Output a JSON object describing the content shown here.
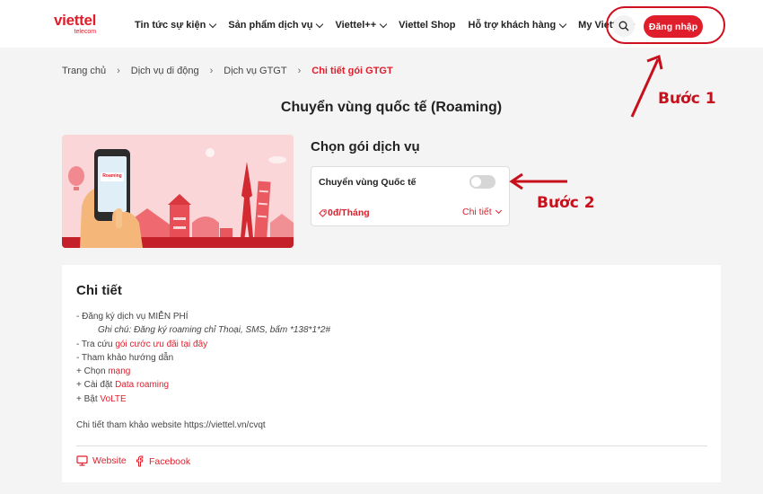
{
  "header": {
    "logo_brand": "viettel",
    "logo_sub": "telecom",
    "nav": [
      {
        "label": "Tin tức sự kiện",
        "has_dropdown": true
      },
      {
        "label": "Sản phẩm dịch vụ",
        "has_dropdown": true
      },
      {
        "label": "Viettel++",
        "has_dropdown": true
      },
      {
        "label": "Viettel Shop",
        "has_dropdown": false
      },
      {
        "label": "Hỗ trợ khách hàng",
        "has_dropdown": true
      },
      {
        "label": "My Viettel",
        "has_dropdown": true
      }
    ],
    "login_label": "Đăng nhập"
  },
  "annotations": {
    "step1": "Bước 1",
    "step2": "Bước 2",
    "color": "#d0101e"
  },
  "breadcrumb": [
    "Trang chủ",
    "Dịch vụ di động",
    "Dịch vụ GTGT",
    "Chi tiết gói GTGT"
  ],
  "page_title": "Chuyển vùng quốc tế (Roaming)",
  "banner": {
    "phone_label": "Roaming"
  },
  "package": {
    "heading": "Chọn gói dịch vụ",
    "name": "Chuyển vùng Quốc tế",
    "toggle_on": false,
    "price": "0đ/Tháng",
    "detail_label": "Chi tiết"
  },
  "details": {
    "title": "Chi tiết",
    "register": "- Đăng ký dịch vụ MIỄN PHÍ",
    "note": "Ghi chú: Đăng ký roaming chỉ Thoại, SMS, bấm *138*1*2#",
    "lookup_prefix": "- Tra cứu ",
    "lookup_link": "gói cước ưu đãi tại đây",
    "guide": "- Tham khảo hướng dẫn",
    "choose_prefix": "+ Chọn ",
    "choose_link": "mạng",
    "settings_prefix": "+ Cài đặt ",
    "settings_link": "Data roaming",
    "enable_prefix": "+ Bật ",
    "enable_link": "VoLTE",
    "reference": "Chi tiết tham khảo website https://viettel.vn/cvqt",
    "website_label": "Website",
    "facebook_label": "Facebook"
  },
  "colors": {
    "brand_red": "#e01e2b",
    "background": "#f4f4f4"
  }
}
